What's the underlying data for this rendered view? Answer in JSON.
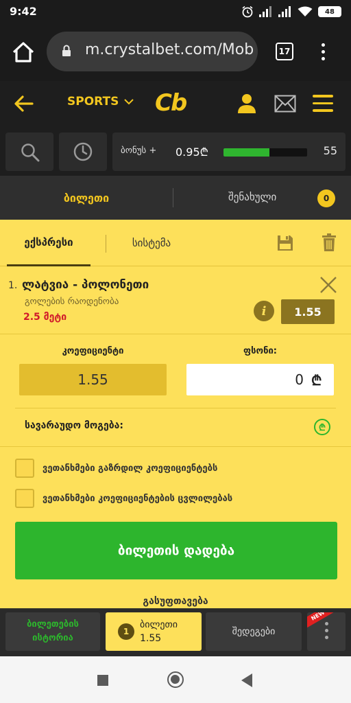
{
  "status_bar": {
    "time": "9:42",
    "battery": "48"
  },
  "browser": {
    "url": "m.crystalbet.com/Mobi",
    "tab_count": "17"
  },
  "header": {
    "sports_label": "SPORTS",
    "logo_text": "Cb"
  },
  "tools": {
    "bonus_label": "ბონუს +",
    "bonus_value": "0.95₾",
    "bonus_progress_fraction": 0.55,
    "bonus_count": "55"
  },
  "bet_tabs": {
    "ticket_label": "ბილეთი",
    "saved_label": "შენახული",
    "saved_count": "0"
  },
  "slip": {
    "tab_express": "ექსპრესი",
    "tab_system": "სისტემა",
    "selection": {
      "number": "1.",
      "name": "ლატვია - პოლონეთი",
      "market": "გოლების რაოდენობა",
      "pick": "2.5 მეტი",
      "odds": "1.55"
    },
    "coef_label": "კოეფიციენტი",
    "stake_label": "ფსონი:",
    "coef_value": "1.55",
    "stake_value": "0",
    "currency": "₾",
    "win_label": "სავარაუდო მოგება:",
    "checkbox1_label": "ვეთანხმები გაზრდილ კოეფიციენტებს",
    "checkbox2_label": "ვეთანხმები კოეფიციენტების ცვლილებას",
    "place_bet_label": "ბილეთის დადება",
    "clean_label": "გასუფთავება"
  },
  "bottom_nav": {
    "history_line1": "ბილეთების",
    "history_line2": "ისტორია",
    "ticket_count": "1",
    "ticket_label": "ბილეთი",
    "ticket_odds": "1.55",
    "results_label": "შედეგები",
    "new_badge": "NEW"
  },
  "colors": {
    "accent_yellow": "#f2c61f",
    "slip_yellow": "#fde05a",
    "green": "#2db52d",
    "red": "#d0192a",
    "dark_bg": "#1e1e1e"
  }
}
